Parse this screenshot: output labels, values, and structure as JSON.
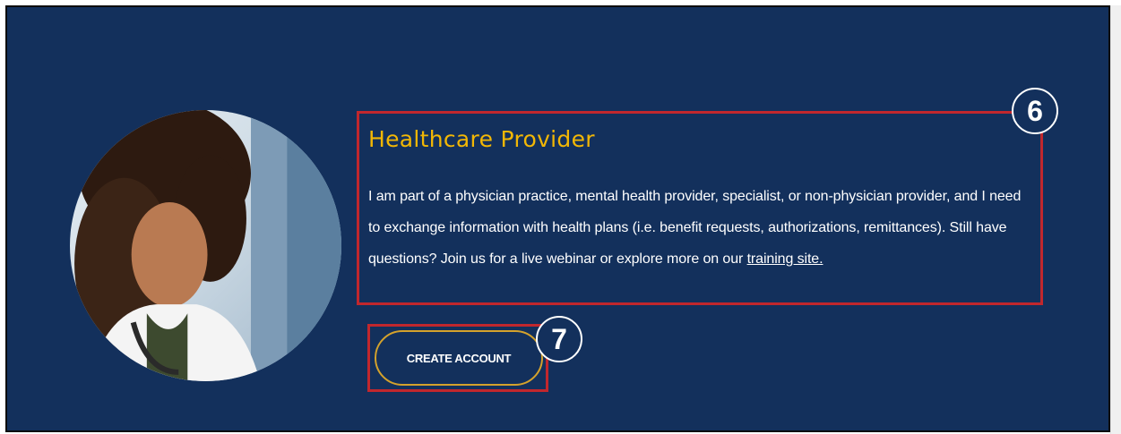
{
  "section": {
    "heading": "Healthcare Provider",
    "description_text": "I am part of a physician practice, mental health provider, specialist, or non-physician provider, and I need to exchange information with health plans (i.e. benefit requests, authorizations, remittances). Still have questions? Join us for a live webinar or explore more on our ",
    "training_link": "training site.",
    "create_account_label": "CREATE ACCOUNT"
  },
  "annotations": {
    "callout_6": "6",
    "callout_7": "7"
  },
  "colors": {
    "background": "#13305c",
    "heading": "#f2b705",
    "highlight_box": "#c1272d",
    "button_border": "#d4a22c"
  }
}
